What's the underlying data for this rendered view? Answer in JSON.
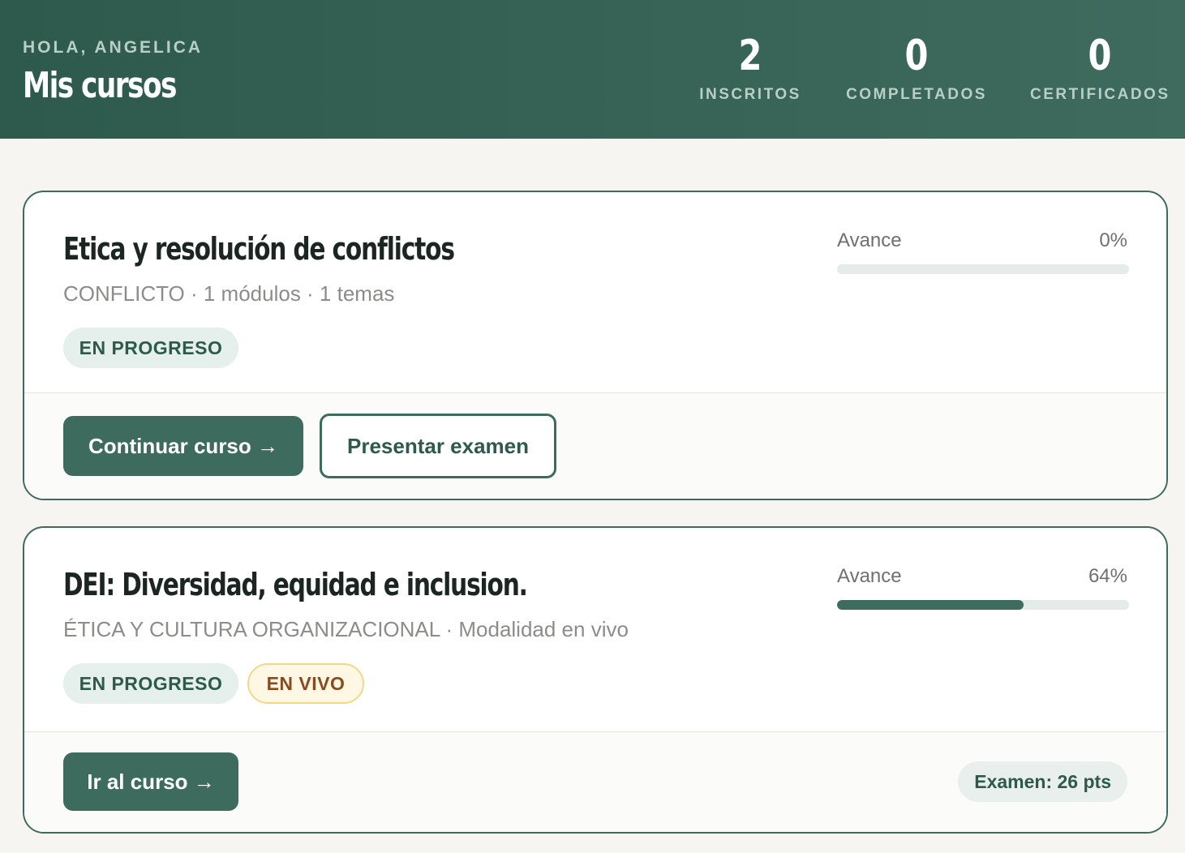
{
  "header": {
    "greeting": "HOLA, ANGELICA",
    "title": "Mis cursos",
    "stats": [
      {
        "value": "2",
        "label": "INSCRITOS"
      },
      {
        "value": "0",
        "label": "COMPLETADOS"
      },
      {
        "value": "0",
        "label": "CERTIFICADOS"
      }
    ]
  },
  "courses": [
    {
      "title": "Etica y resolución de conflictos",
      "meta": "CONFLICTO · 1 módulos · 1 temas",
      "badges": [
        "EN PROGRESO"
      ],
      "progress_label": "Avance",
      "progress_percent": 0,
      "progress_text": "0%",
      "primary_action": "Continuar curso →",
      "secondary_action": "Presentar examen"
    },
    {
      "title": "DEI: Diversidad, equidad e inclusion.",
      "meta": "ÉTICA Y CULTURA ORGANIZACIONAL · Modalidad en vivo",
      "badges": [
        "EN PROGRESO",
        "EN VIVO"
      ],
      "progress_label": "Avance",
      "progress_percent": 64,
      "progress_text": "64%",
      "primary_action": "Ir al curso →",
      "exam_score": "Examen: 26 pts"
    }
  ],
  "colors": {
    "primary": "#3d6b5d",
    "header_dark": "#2d5a4d",
    "background": "#f6f5f1",
    "live_badge_text": "#8a4a1e",
    "live_badge_border": "#f1d98a"
  }
}
